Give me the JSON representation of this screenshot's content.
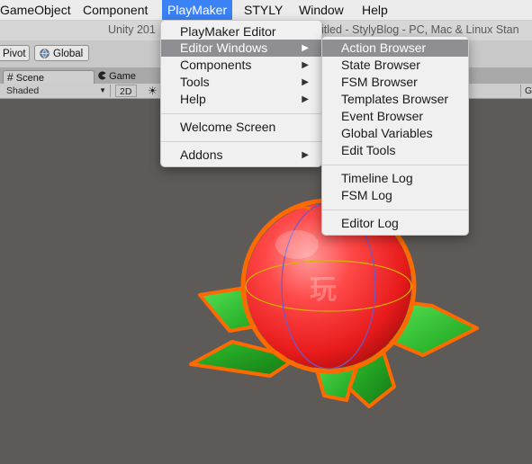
{
  "menubar": {
    "items": [
      "GameObject",
      "Component",
      "PlayMaker",
      "STYLY",
      "Window",
      "Help"
    ],
    "active": "PlayMaker"
  },
  "title": {
    "left": "Unity 201",
    "right": "itled - StylyBlog - PC, Mac & Linux Stan"
  },
  "toolbar": {
    "pivot_label": "Pivot",
    "global_label": "Global"
  },
  "tabs": {
    "scene": "Scene",
    "game": "Game"
  },
  "scene_bar": {
    "shading": "Shaded",
    "mode": "2D",
    "gizmos": "Gi"
  },
  "scene": {
    "watermark": "玩"
  },
  "playmaker_menu": {
    "items": [
      {
        "label": "PlayMaker Editor",
        "submenu": false
      },
      {
        "label": "Editor Windows",
        "submenu": true,
        "highlighted": true
      },
      {
        "label": "Components",
        "submenu": true
      },
      {
        "label": "Tools",
        "submenu": true
      },
      {
        "label": "Help",
        "submenu": true
      },
      {
        "label": "Welcome Screen",
        "submenu": false
      },
      {
        "label": "Addons",
        "submenu": true
      }
    ]
  },
  "editor_windows_menu": {
    "items": [
      {
        "label": "Action Browser",
        "highlighted": true
      },
      {
        "label": "State Browser"
      },
      {
        "label": "FSM Browser"
      },
      {
        "label": "Templates Browser"
      },
      {
        "label": "Event Browser"
      },
      {
        "label": "Global Variables"
      },
      {
        "label": "Edit Tools"
      },
      {
        "label": "Timeline Log"
      },
      {
        "label": "FSM Log"
      },
      {
        "label": "Editor Log"
      }
    ]
  },
  "colors": {
    "menu_highlight": "#8e8e93",
    "menubar_active": "#3b82f6",
    "scene_background": "#5e5a57",
    "selection_outline": "#ff6a00",
    "sphere": "#ff3b3b",
    "leaves": "#33cc33"
  },
  "icons": [
    "scene-grid-icon",
    "game-pacman-icon",
    "global-sphere-icon",
    "sun-icon",
    "submenu-arrow-icon"
  ]
}
